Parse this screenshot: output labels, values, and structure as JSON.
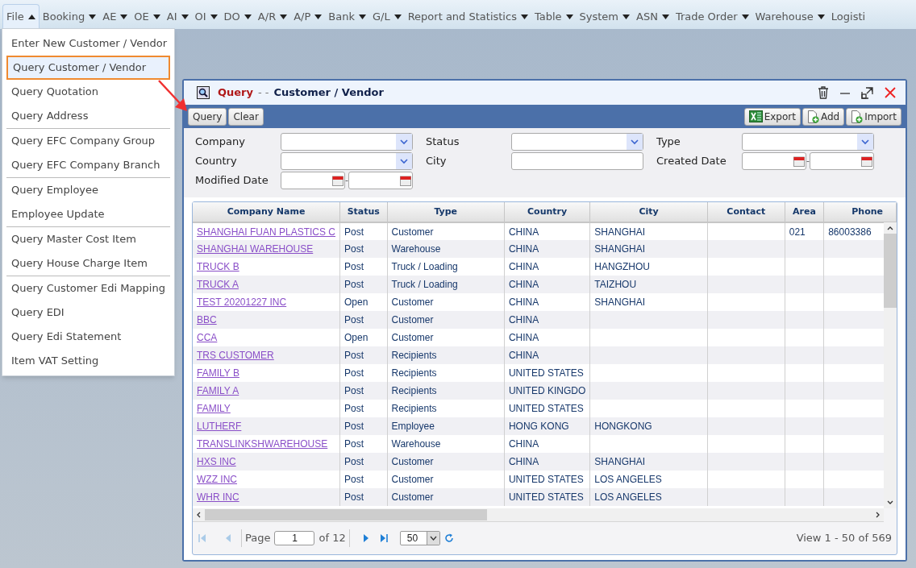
{
  "menu_bar": [
    {
      "label": "File",
      "open": true
    },
    {
      "label": "Booking",
      "open": false
    },
    {
      "label": "AE",
      "open": false
    },
    {
      "label": "OE",
      "open": false
    },
    {
      "label": "AI",
      "open": false
    },
    {
      "label": "OI",
      "open": false
    },
    {
      "label": "DO",
      "open": false
    },
    {
      "label": "A/R",
      "open": false
    },
    {
      "label": "A/P",
      "open": false
    },
    {
      "label": "Bank",
      "open": false
    },
    {
      "label": "G/L",
      "open": false
    },
    {
      "label": "Report and Statistics",
      "open": false
    },
    {
      "label": "Table",
      "open": false
    },
    {
      "label": "System",
      "open": false
    },
    {
      "label": "ASN",
      "open": false
    },
    {
      "label": "Trade Order",
      "open": false
    },
    {
      "label": "Warehouse",
      "open": false
    },
    {
      "label": "Logisti",
      "open": false
    }
  ],
  "file_menu": [
    {
      "label": "Enter New Customer / Vendor",
      "selected": false
    },
    {
      "label": "Query Customer / Vendor",
      "selected": true
    },
    {
      "label": "Query Quotation",
      "selected": false
    },
    {
      "label": "Query Address",
      "selected": false,
      "divider_after": true
    },
    {
      "label": "Query EFC Company Group",
      "selected": false
    },
    {
      "label": "Query EFC Company Branch",
      "selected": false,
      "divider_after": true
    },
    {
      "label": "Query Employee",
      "selected": false
    },
    {
      "label": "Employee Update",
      "selected": false,
      "divider_after": true
    },
    {
      "label": "Query Master Cost Item",
      "selected": false
    },
    {
      "label": "Query House Charge Item",
      "selected": false,
      "divider_after": true
    },
    {
      "label": "Query Customer Edi Mapping",
      "selected": false
    },
    {
      "label": "Query EDI",
      "selected": false
    },
    {
      "label": "Query Edi Statement",
      "selected": false
    },
    {
      "label": "Item VAT Setting",
      "selected": false
    }
  ],
  "window": {
    "title_action": "Query",
    "title_separator": "- -",
    "title_subject": "Customer / Vendor"
  },
  "toolbar": {
    "left": [
      "Query",
      "Clear"
    ],
    "right": [
      {
        "label": "Export",
        "kind": "excel"
      },
      {
        "label": "Add",
        "kind": "add"
      },
      {
        "label": "Import",
        "kind": "add"
      }
    ]
  },
  "filters": [
    {
      "label": "Company",
      "kind": "select"
    },
    {
      "label": "Status",
      "kind": "select"
    },
    {
      "label": "Type",
      "kind": "select"
    },
    {
      "label": "Country",
      "kind": "select"
    },
    {
      "label": "City",
      "kind": "text"
    },
    {
      "label": "Created Date",
      "kind": "daterange",
      "separator": "-"
    },
    {
      "label": "Modified Date",
      "kind": "daterange",
      "separator": "-"
    }
  ],
  "table": {
    "columns": [
      "Company Name",
      "Status",
      "Type",
      "Country",
      "City",
      "Contact",
      "Area",
      "Phone"
    ],
    "rows": [
      [
        "SHANGHAI FUAN PLASTICS C",
        "Post",
        "Customer",
        "CHINA",
        "SHANGHAI",
        "",
        "021",
        "86003386"
      ],
      [
        "SHANGHAI WAREHOUSE",
        "Post",
        "Warehouse",
        "CHINA",
        "SHANGHAI",
        "",
        "",
        ""
      ],
      [
        "TRUCK B",
        "Post",
        "Truck / Loading",
        "CHINA",
        "HANGZHOU",
        "",
        "",
        ""
      ],
      [
        "TRUCK A",
        "Post",
        "Truck / Loading",
        "CHINA",
        "TAIZHOU",
        "",
        "",
        ""
      ],
      [
        "TEST 20201227 INC",
        "Open",
        "Customer",
        "CHINA",
        "SHANGHAI",
        "",
        "",
        ""
      ],
      [
        "BBC",
        "Post",
        "Customer",
        "CHINA",
        "",
        "",
        "",
        ""
      ],
      [
        "CCA",
        "Open",
        "Customer",
        "CHINA",
        "",
        "",
        "",
        ""
      ],
      [
        "TRS CUSTOMER",
        "Post",
        "Recipients",
        "CHINA",
        "",
        "",
        "",
        ""
      ],
      [
        "FAMILY B",
        "Post",
        "Recipients",
        "UNITED STATES",
        "",
        "",
        "",
        ""
      ],
      [
        "FAMILY A",
        "Post",
        "Recipients",
        "UNITED KINGDO",
        "",
        "",
        "",
        ""
      ],
      [
        "FAMILY",
        "Post",
        "Recipients",
        "UNITED STATES",
        "",
        "",
        "",
        ""
      ],
      [
        "LUTHERF",
        "Post",
        "Employee",
        "HONG KONG",
        "HONGKONG",
        "",
        "",
        ""
      ],
      [
        "TRANSLINKSHWAREHOUSE",
        "Post",
        "Warehouse",
        "CHINA",
        "",
        "",
        "",
        ""
      ],
      [
        "HXS INC",
        "Post",
        "Customer",
        "CHINA",
        "SHANGHAI",
        "",
        "",
        ""
      ],
      [
        "WZZ INC",
        "Post",
        "Customer",
        "UNITED STATES",
        "LOS ANGELES",
        "",
        "",
        ""
      ],
      [
        "WHR INC",
        "Post",
        "Customer",
        "UNITED STATES",
        "LOS ANGELES",
        "",
        "",
        ""
      ]
    ]
  },
  "pager": {
    "page_label": "Page",
    "page": "1",
    "of_label": "of 12",
    "page_size": "50",
    "summary": "View 1 - 50 of 569"
  }
}
